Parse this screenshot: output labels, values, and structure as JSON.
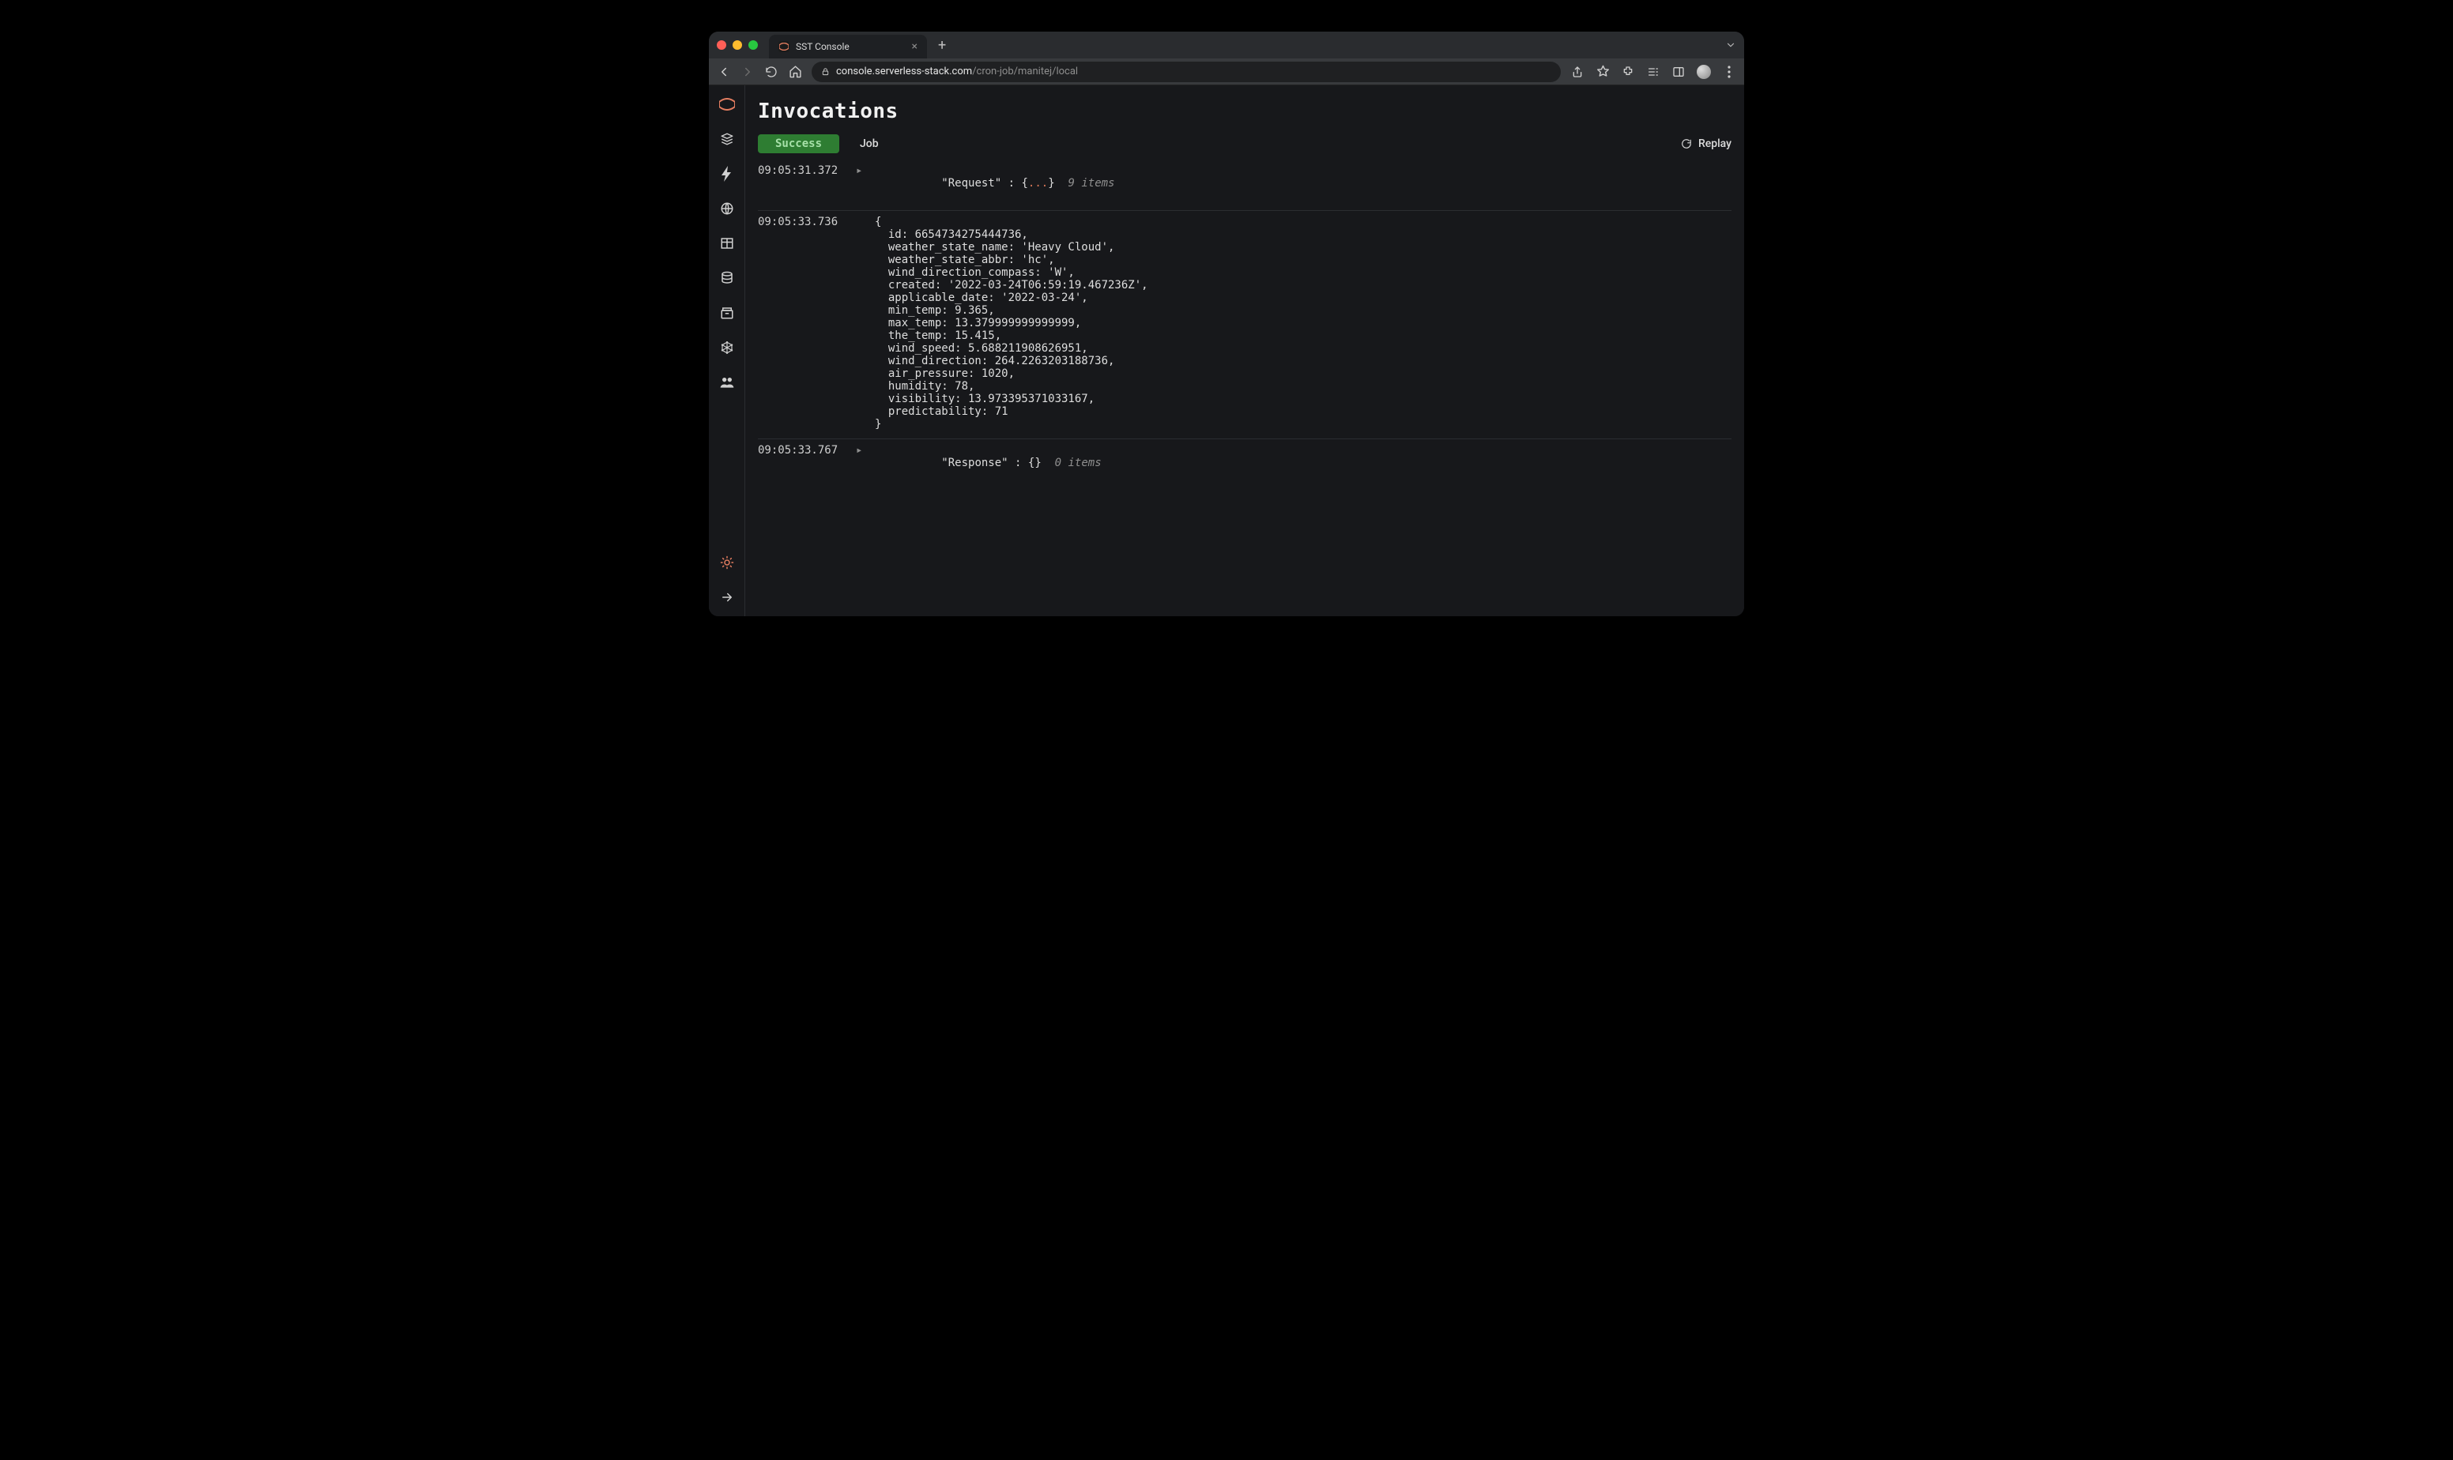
{
  "browser": {
    "tab_title": "SST Console",
    "url_host": "console.serverless-stack.com",
    "url_path": "/cron-job/manitej/local"
  },
  "page": {
    "title": "Invocations",
    "status_badge": "Success",
    "job_label": "Job",
    "replay_label": "Replay"
  },
  "logs": {
    "row0": {
      "ts": "09:05:31.372",
      "label": "\"Request\"",
      "sep": " : ",
      "open": "{",
      "dots": "...",
      "close": "}",
      "meta": "9 items"
    },
    "row1": {
      "ts": "09:05:33.736",
      "body": "{\n  id: 6654734275444736,\n  weather_state_name: 'Heavy Cloud',\n  weather_state_abbr: 'hc',\n  wind_direction_compass: 'W',\n  created: '2022-03-24T06:59:19.467236Z',\n  applicable_date: '2022-03-24',\n  min_temp: 9.365,\n  max_temp: 13.379999999999999,\n  the_temp: 15.415,\n  wind_speed: 5.688211908626951,\n  wind_direction: 264.2263203188736,\n  air_pressure: 1020,\n  humidity: 78,\n  visibility: 13.973395371033167,\n  predictability: 71\n}"
    },
    "row2": {
      "ts": "09:05:33.767",
      "label": "\"Response\"",
      "sep": " : ",
      "open": "{",
      "close": "}",
      "meta": "0 items"
    }
  }
}
